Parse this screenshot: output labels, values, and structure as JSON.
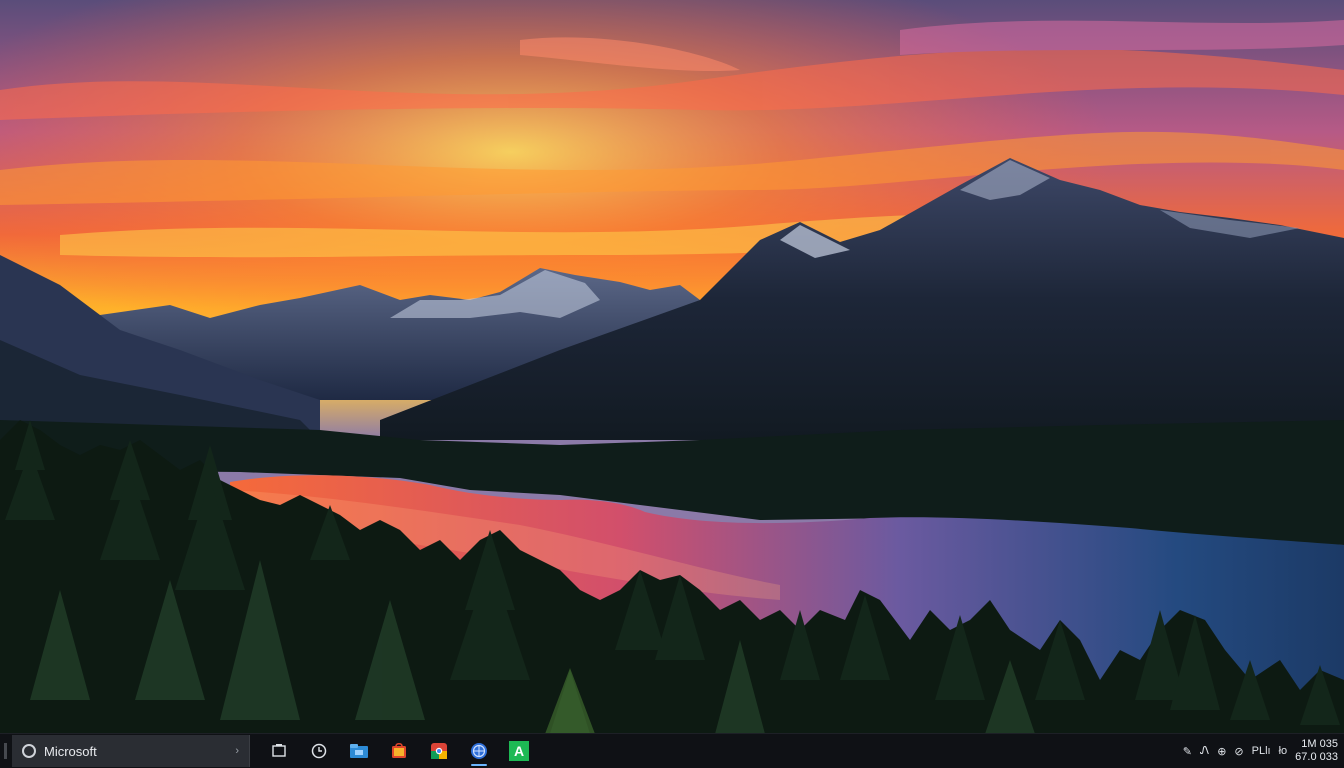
{
  "taskbar": {
    "search_label": "Microsoft",
    "apps": [
      {
        "name": "task-view-icon"
      },
      {
        "name": "clock-app-icon"
      },
      {
        "name": "folder-icon"
      },
      {
        "name": "store-icon"
      },
      {
        "name": "chrome-icon"
      },
      {
        "name": "globe-app-icon"
      },
      {
        "name": "green-app-icon",
        "glyph": "A"
      }
    ],
    "tray": {
      "labels": [
        "Ꮑ",
        "⊕",
        "⊘",
        "⊛"
      ],
      "lang": "PLlı",
      "lang_short": "ło"
    },
    "clock": {
      "time": "1M 035",
      "date": "67.0 033"
    }
  },
  "colors": {
    "taskbar_bg": "#0f1115",
    "search_bg": "#2a2d33",
    "folder": "#2d8bd6",
    "store": "#e0462b",
    "chrome_red": "#db4437",
    "chrome_yellow": "#f4b400",
    "chrome_green": "#0f9d58",
    "globe": "#2f6fd8",
    "green_app": "#1db954"
  }
}
